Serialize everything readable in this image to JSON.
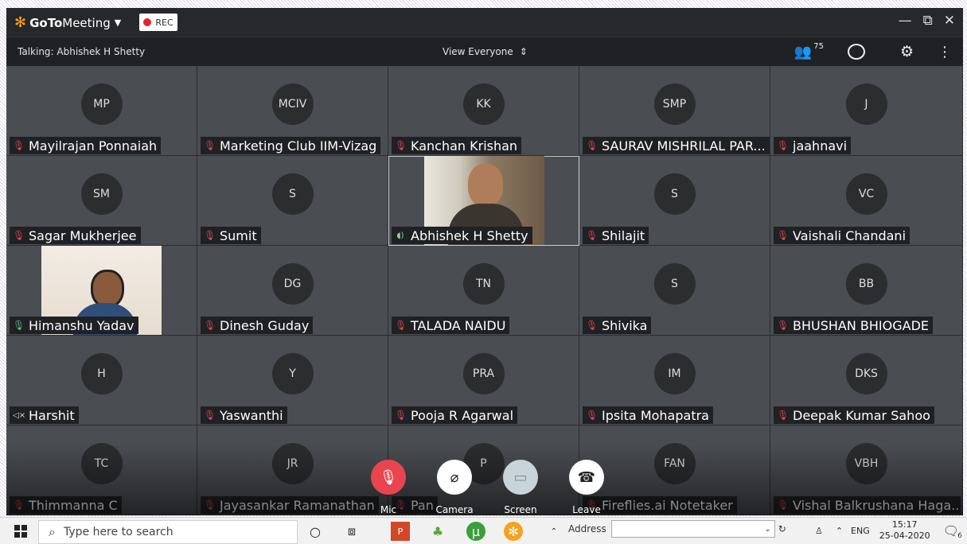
{
  "app": {
    "name_bold": "GoTo",
    "name_rest": "Meeting",
    "rec_label": "REC",
    "window_controls": [
      "minimize-icon",
      "restore-icon",
      "close-icon"
    ]
  },
  "subbar": {
    "talking": "Talking: Abhishek H Shetty",
    "view": "View Everyone",
    "attendee_count": "75"
  },
  "participants": [
    {
      "initials": "MP",
      "name": "Mayilrajan Ponnaiah",
      "mic": "muted"
    },
    {
      "initials": "MCIV",
      "name": "Marketing Club IIM-Vizag",
      "mic": "muted"
    },
    {
      "initials": "KK",
      "name": "Kanchan Krishan",
      "mic": "muted"
    },
    {
      "initials": "SMP",
      "name": "SAURAV MISHRILAL PAR...",
      "mic": "muted"
    },
    {
      "initials": "J",
      "name": "jaahnavi",
      "mic": "muted"
    },
    {
      "initials": "SM",
      "name": "Sagar Mukherjee",
      "mic": "muted"
    },
    {
      "initials": "S",
      "name": "Sumit",
      "mic": "muted"
    },
    {
      "initials": "",
      "name": "Abhishek H Shetty",
      "mic": "speaking",
      "video": true
    },
    {
      "initials": "S",
      "name": "Shilajit",
      "mic": "muted"
    },
    {
      "initials": "VC",
      "name": "Vaishali Chandani",
      "mic": "muted"
    },
    {
      "initials": "",
      "name": "Himanshu Yadav",
      "mic": "on",
      "video": true
    },
    {
      "initials": "DG",
      "name": "Dinesh Guday",
      "mic": "muted"
    },
    {
      "initials": "TN",
      "name": "TALADA NAIDU",
      "mic": "muted"
    },
    {
      "initials": "S",
      "name": "Shivika",
      "mic": "muted"
    },
    {
      "initials": "BB",
      "name": "BHUSHAN BHIOGADE",
      "mic": "muted"
    },
    {
      "initials": "H",
      "name": "Harshit",
      "mic": "speaker-muted"
    },
    {
      "initials": "Y",
      "name": "Yaswanthi",
      "mic": "muted"
    },
    {
      "initials": "PRA",
      "name": "Pooja R Agarwal",
      "mic": "muted"
    },
    {
      "initials": "IM",
      "name": "Ipsita Mohapatra",
      "mic": "muted"
    },
    {
      "initials": "DKS",
      "name": "Deepak Kumar Sahoo",
      "mic": "muted"
    },
    {
      "initials": "TC",
      "name": "Thimmanna C",
      "mic": "muted"
    },
    {
      "initials": "JR",
      "name": "Jayasankar Ramanathan",
      "mic": "muted"
    },
    {
      "initials": "P",
      "name": "Pan",
      "mic": "muted"
    },
    {
      "initials": "FAN",
      "name": "Fireflies.ai Notetaker",
      "mic": "muted"
    },
    {
      "initials": "VBH",
      "name": "Vishal Balkrushana Haga...",
      "mic": "muted"
    }
  ],
  "controls": {
    "mic": "Mic",
    "camera": "Camera",
    "screen": "Screen",
    "leave": "Leave"
  },
  "colors": {
    "accent_orange": "#f6a21b",
    "muted_red": "#e0484f",
    "mic_on_green": "#57c67a",
    "leave_red": "#e9454f"
  },
  "taskbar": {
    "search_placeholder": "Type here to search",
    "address_label": "Address",
    "lang": "ENG",
    "time": "15:17",
    "date": "25-04-2020",
    "notif_count": "6"
  }
}
